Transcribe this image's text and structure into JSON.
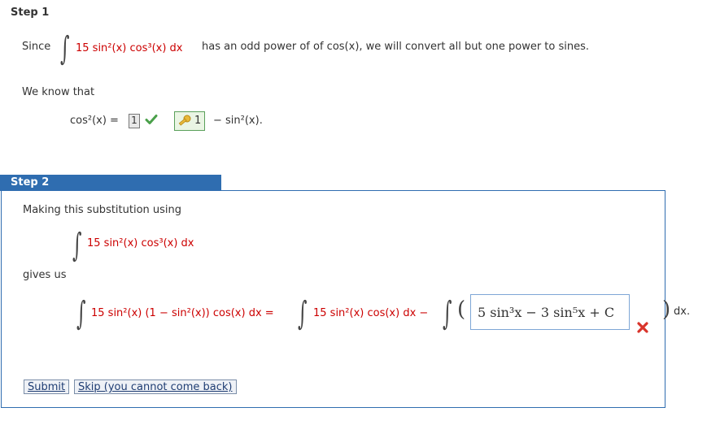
{
  "step1": {
    "heading": "Step 1",
    "since": "Since",
    "integrand": "15 sin²(x) cos³(x) dx",
    "explanation": "has an odd power of of cos(x), we will convert all but one power to sines.",
    "know": "We know that",
    "identity_lhs": "cos²(x) =",
    "answer1_value": "1",
    "key_value": "1",
    "identity_rhs": "− sin²(x)."
  },
  "step2": {
    "heading": "Step 2",
    "making": "Making this substitution using",
    "integrand": "15 sin²(x) cos³(x) dx",
    "gives": "gives us",
    "lhs_integrand": "15 sin²(x) (1 − sin²(x)) cos(x) dx =",
    "mid_integrand": "15 sin²(x) cos(x) dx −",
    "answer_value": "5 sin³x − 3 sin⁵x + C",
    "dx": "dx.",
    "submit_label": "Submit",
    "skip_label": "Skip (you cannot come back)"
  },
  "colors": {
    "accent": "#2f6db0",
    "red": "#cc0000",
    "check": "#4aa04a"
  }
}
